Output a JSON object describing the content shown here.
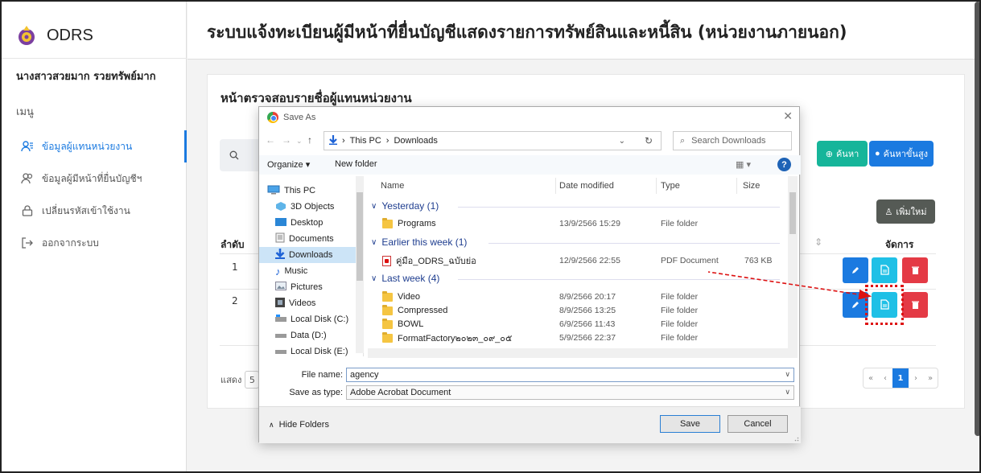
{
  "app": {
    "brand": "ODRS",
    "title": "ระบบแจ้งทะเบียนผู้มีหน้าที่ยื่นบัญชีแสดงรายการทรัพย์สินและหนี้สิน (หน่วยงานภายนอก)"
  },
  "sidebar": {
    "user_name": "นางสาวสวยมาก รวยทรัพย์มาก",
    "menu_title": "เมนู",
    "items": [
      {
        "label": "ข้อมูลผู้แทนหน่วยงาน",
        "icon": "user-list-icon",
        "active": true
      },
      {
        "label": "ข้อมูลผู้มีหน้าที่ยื่นบัญชีฯ",
        "icon": "users-icon",
        "active": false
      },
      {
        "label": "เปลี่ยนรหัสเข้าใช้งาน",
        "icon": "lock-icon",
        "active": false
      },
      {
        "label": "ออกจากระบบ",
        "icon": "logout-icon",
        "active": false
      }
    ]
  },
  "page": {
    "card_title": "หน้าตรวจสอบรายชื่อผู้แทนหน่วยงาน",
    "search_label": "ค้นหา",
    "advanced_search_label": "ค้นหาขั้นสูง",
    "add_label": "เพิ่มใหม่",
    "columns": {
      "index": "ลำดับ",
      "actions": "จัดการ"
    },
    "rows": [
      {
        "index": "1"
      },
      {
        "index": "2"
      }
    ],
    "show_label": "แสดง",
    "show_value": "5",
    "pager": {
      "first": "«",
      "prev": "‹",
      "current": "1",
      "next": "›",
      "last": "»"
    }
  },
  "dialog": {
    "title": "Save As",
    "breadcrumb": [
      "This PC",
      "Downloads"
    ],
    "search_placeholder": "Search Downloads",
    "organize_label": "Organize ▾",
    "new_folder_label": "New folder",
    "view_label": "▦ ▾",
    "help_label": "?",
    "tree": [
      {
        "label": "This PC",
        "icon": "computer-icon"
      },
      {
        "label": "3D Objects",
        "icon": "3d-objects-icon"
      },
      {
        "label": "Desktop",
        "icon": "desktop-icon"
      },
      {
        "label": "Documents",
        "icon": "documents-icon"
      },
      {
        "label": "Downloads",
        "icon": "downloads-icon",
        "selected": true
      },
      {
        "label": "Music",
        "icon": "music-icon"
      },
      {
        "label": "Pictures",
        "icon": "pictures-icon"
      },
      {
        "label": "Videos",
        "icon": "videos-icon"
      },
      {
        "label": "Local Disk (C:)",
        "icon": "drive-icon"
      },
      {
        "label": "Data (D:)",
        "icon": "drive-icon"
      },
      {
        "label": "Local Disk (E:)",
        "icon": "drive-icon"
      }
    ],
    "columns": {
      "name": "Name",
      "date": "Date modified",
      "type": "Type",
      "size": "Size"
    },
    "groups": [
      {
        "label": "Yesterday (1)",
        "files": [
          {
            "name": "Programs",
            "date": "13/9/2566 15:29",
            "type": "File folder",
            "size": "",
            "kind": "folder"
          }
        ]
      },
      {
        "label": "Earlier this week (1)",
        "files": [
          {
            "name": "คู่มือ_ODRS_ฉบับย่อ",
            "date": "12/9/2566 22:55",
            "type": "PDF Document",
            "size": "763 KB",
            "kind": "pdf"
          }
        ]
      },
      {
        "label": "Last week (4)",
        "files": [
          {
            "name": "Video",
            "date": "8/9/2566 20:17",
            "type": "File folder",
            "size": "",
            "kind": "folder"
          },
          {
            "name": "Compressed",
            "date": "8/9/2566 13:25",
            "type": "File folder",
            "size": "",
            "kind": "folder"
          },
          {
            "name": "BOWL",
            "date": "6/9/2566 11:43",
            "type": "File folder",
            "size": "",
            "kind": "folder"
          },
          {
            "name": "FormatFactory๒๐๒๓_๐๙_๐๕",
            "date": "5/9/2566 22:37",
            "type": "File folder",
            "size": "",
            "kind": "folder"
          }
        ]
      }
    ],
    "file_name_label": "File name:",
    "file_name_value": "agency",
    "save_type_label": "Save as type:",
    "save_type_value": "Adobe Acrobat Document",
    "hide_folders_label": "Hide Folders",
    "save_label": "Save",
    "cancel_label": "Cancel"
  },
  "colors": {
    "accent": "#1b7ae0",
    "search_btn": "#16b59a",
    "view_btn": "#1fc0e6",
    "delete_btn": "#e43a45",
    "annotation": "#dd1111"
  }
}
